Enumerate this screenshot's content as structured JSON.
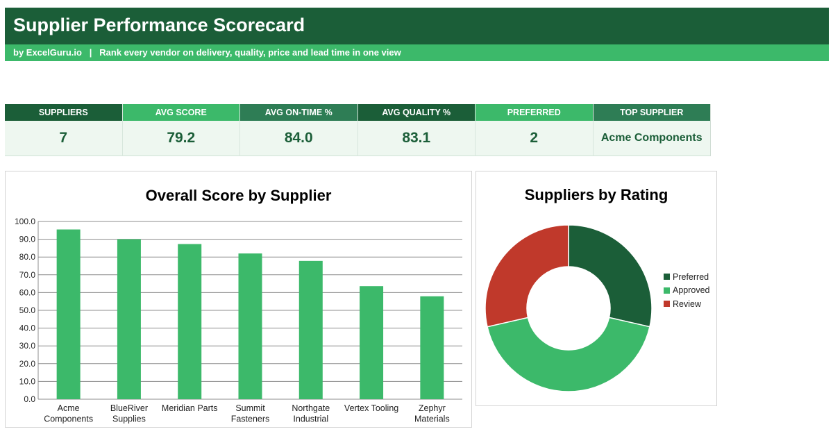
{
  "header": {
    "title": "Supplier Performance Scorecard",
    "subtitle": "by ExcelGuru.io   |   Rank every vendor on delivery, quality, price and lead time in one view"
  },
  "kpis": [
    {
      "label": "SUPPLIERS",
      "value": "7",
      "header_color": "#1b5e38"
    },
    {
      "label": "AVG SCORE",
      "value": "79.2",
      "header_color": "#3cb96a"
    },
    {
      "label": "AVG ON-TIME %",
      "value": "84.0",
      "header_color": "#2e7d55"
    },
    {
      "label": "AVG QUALITY %",
      "value": "83.1",
      "header_color": "#1b5e38"
    },
    {
      "label": "PREFERRED",
      "value": "2",
      "header_color": "#3cb96a"
    },
    {
      "label": "TOP SUPPLIER",
      "value": "Acme Components",
      "header_color": "#2e7d55"
    }
  ],
  "chart_data": [
    {
      "type": "bar",
      "title": "Overall Score by Supplier",
      "categories": [
        "Acme Components",
        "BlueRiver Supplies",
        "Meridian Parts",
        "Summit Fasteners",
        "Northgate Industrial",
        "Vertex Tooling",
        "Zephyr Materials"
      ],
      "category_lines": [
        [
          "Acme",
          "Components"
        ],
        [
          "BlueRiver",
          "Supplies"
        ],
        [
          "Meridian Parts"
        ],
        [
          "Summit",
          "Fasteners"
        ],
        [
          "Northgate",
          "Industrial"
        ],
        [
          "Vertex Tooling"
        ],
        [
          "Zephyr",
          "Materials"
        ]
      ],
      "values": [
        95.5,
        90.0,
        87.3,
        82.0,
        77.8,
        63.6,
        57.9
      ],
      "ylim": [
        0,
        100
      ],
      "yticks": [
        "0.0",
        "10.0",
        "20.0",
        "30.0",
        "40.0",
        "50.0",
        "60.0",
        "70.0",
        "80.0",
        "90.0",
        "100.0"
      ],
      "grid": true,
      "color": "#3cb96a"
    },
    {
      "type": "pie",
      "donut": true,
      "title": "Suppliers by Rating",
      "labels": [
        "Preferred",
        "Approved",
        "Review"
      ],
      "values": [
        2,
        3,
        2
      ],
      "colors": [
        "#1b5e38",
        "#3cb96a",
        "#c0392b"
      ],
      "legend": "right"
    }
  ]
}
